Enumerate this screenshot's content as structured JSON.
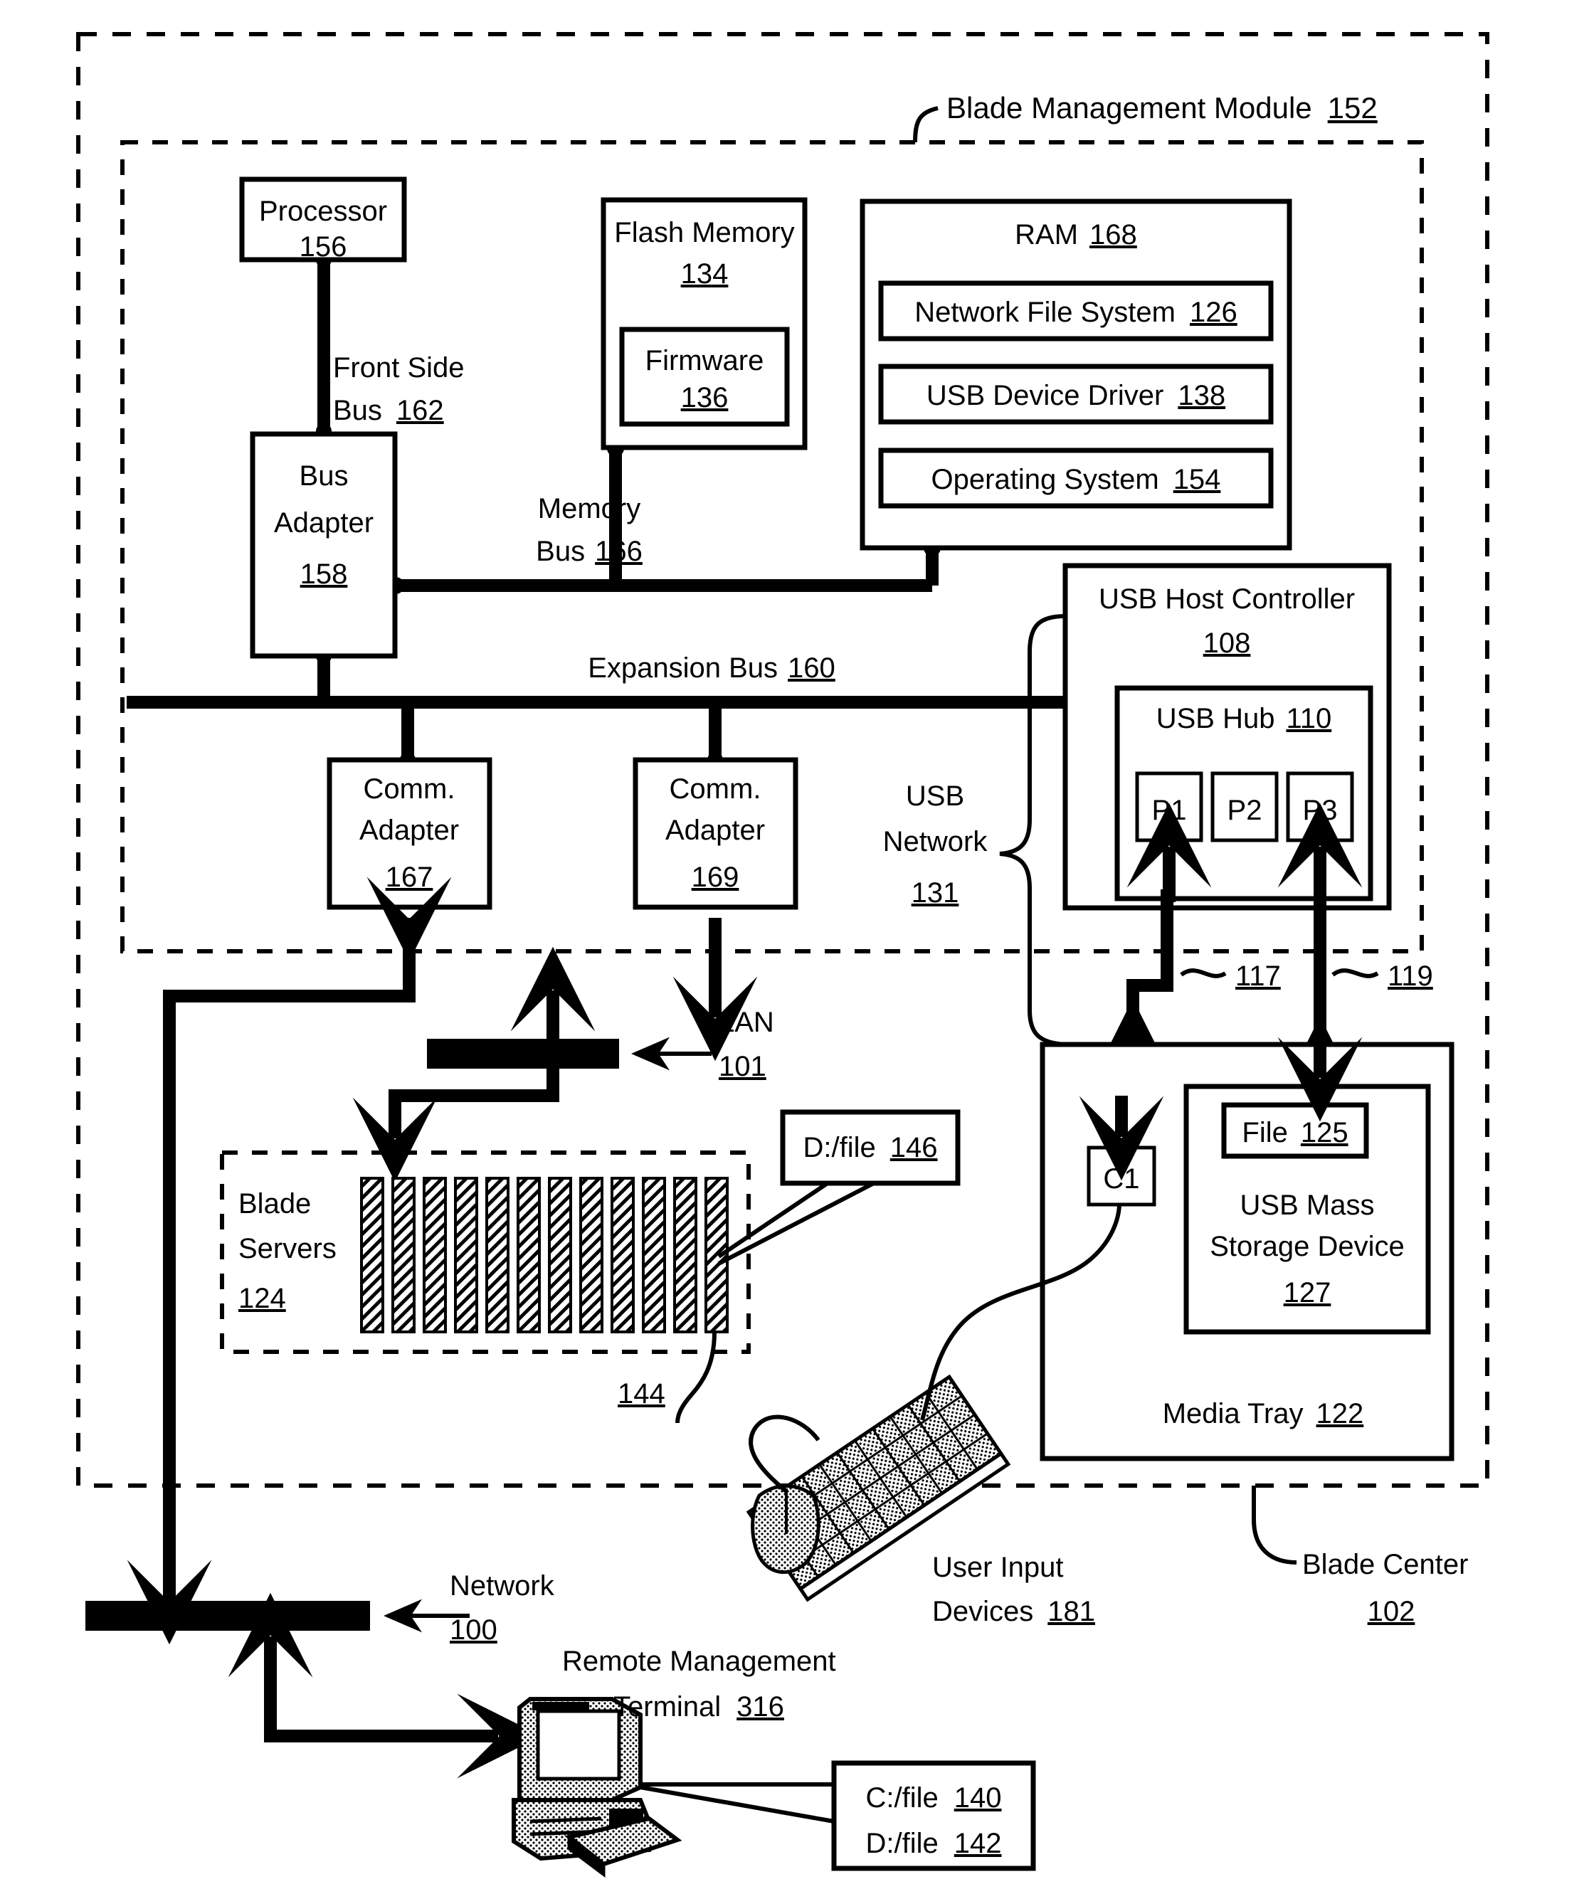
{
  "figure": {
    "type": "patent-block-diagram",
    "outer_enclosure": {
      "label": "Blade Center",
      "ref": "102"
    },
    "inner_enclosure": {
      "label": "Blade Management Module",
      "ref": "152"
    }
  },
  "blocks": {
    "processor": {
      "line1": "Processor",
      "ref": "156"
    },
    "flash_memory": {
      "line1": "Flash Memory",
      "ref": "134"
    },
    "firmware": {
      "line1": "Firmware",
      "ref": "136"
    },
    "ram": {
      "line1": "RAM",
      "ref": "168"
    },
    "network_file_system": {
      "line1": "Network File System",
      "ref": "126"
    },
    "usb_device_driver": {
      "line1": "USB Device Driver",
      "ref": "138"
    },
    "operating_system": {
      "line1": "Operating System",
      "ref": "154"
    },
    "bus_adapter": {
      "line1": "Bus",
      "line2": "Adapter",
      "ref": "158"
    },
    "comm_adapter_167": {
      "line1": "Comm.",
      "line2": "Adapter",
      "ref": "167"
    },
    "comm_adapter_169": {
      "line1": "Comm.",
      "line2": "Adapter",
      "ref": "169"
    },
    "usb_host_controller": {
      "line1": "USB Host Controller",
      "ref": "108"
    },
    "usb_hub": {
      "line1": "USB Hub",
      "ref": "110"
    },
    "port_p1": {
      "line1": "P1"
    },
    "port_p2": {
      "line1": "P2"
    },
    "port_p3": {
      "line1": "P3"
    },
    "connector_c1": {
      "line1": "C1"
    },
    "media_tray": {
      "line1": "Media Tray",
      "ref": "122"
    },
    "usb_mass_storage": {
      "line1": "USB Mass",
      "line2": "Storage Device",
      "ref": "127"
    },
    "file_125": {
      "line1": "File",
      "ref": "125"
    },
    "blade_servers": {
      "line1": "Blade",
      "line2": "Servers",
      "ref": "124"
    },
    "d_file_146": {
      "line1": "D:/file",
      "ref": "146"
    },
    "c_file_140": {
      "line1": "C:/file",
      "ref": "140"
    },
    "d_file_142": {
      "line1": "D:/file",
      "ref": "142"
    }
  },
  "buses": {
    "front_side_bus": {
      "line1": "Front Side",
      "line2": "Bus",
      "ref": "162"
    },
    "memory_bus": {
      "line1": "Memory",
      "line2": "Bus",
      "ref": "166"
    },
    "expansion_bus": {
      "line1": "Expansion Bus",
      "ref": "160"
    },
    "usb_network": {
      "line1": "USB",
      "line2": "Network",
      "ref": "131"
    },
    "lan": {
      "line1": "LAN",
      "ref": "101"
    },
    "network": {
      "line1": "Network",
      "ref": "100"
    }
  },
  "callouts": {
    "blade_chassis_ref": "144",
    "usb_cable_117": "117",
    "usb_cable_119": "119",
    "user_input_devices": {
      "line1": "User Input",
      "line2": "Devices",
      "ref": "181"
    },
    "remote_management_terminal": {
      "line1": "Remote Management",
      "line2": "Terminal",
      "ref": "316"
    }
  },
  "colors": {
    "ink": "#000000",
    "paper": "#ffffff"
  }
}
